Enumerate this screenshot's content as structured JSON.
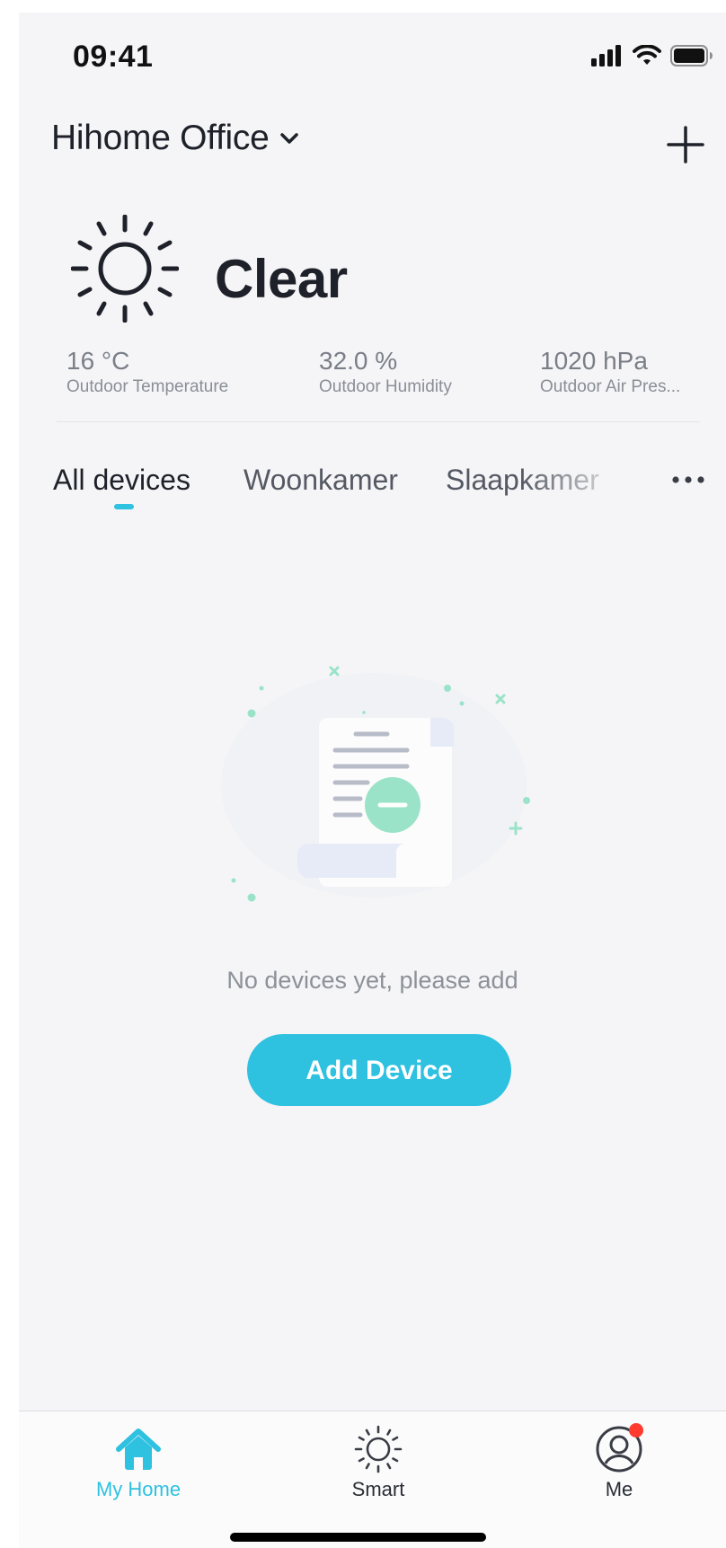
{
  "status_bar": {
    "time": "09:41"
  },
  "header": {
    "home_name": "Hihome Office"
  },
  "weather": {
    "condition": "Clear",
    "metrics": [
      {
        "value": "16 °C",
        "label": "Outdoor Temperature"
      },
      {
        "value": "32.0 %",
        "label": "Outdoor Humidity"
      },
      {
        "value": "1020 hPa",
        "label": "Outdoor Air Pres..."
      }
    ]
  },
  "tabs": [
    {
      "label": "All devices",
      "active": true
    },
    {
      "label": "Woonkamer",
      "active": false
    },
    {
      "label": "Slaapkamer",
      "active": false
    }
  ],
  "empty_state": {
    "message": "No devices yet, please add",
    "button_label": "Add Device"
  },
  "bottom_nav": [
    {
      "label": "My Home",
      "icon": "home-icon",
      "active": true
    },
    {
      "label": "Smart",
      "icon": "sun-icon",
      "active": false
    },
    {
      "label": "Me",
      "icon": "user-icon",
      "active": false,
      "badge": true
    }
  ],
  "colors": {
    "accent": "#2ec1e0",
    "background": "#f5f5f7",
    "badge": "#ff3b30",
    "illustration_green": "#9be3c8"
  }
}
